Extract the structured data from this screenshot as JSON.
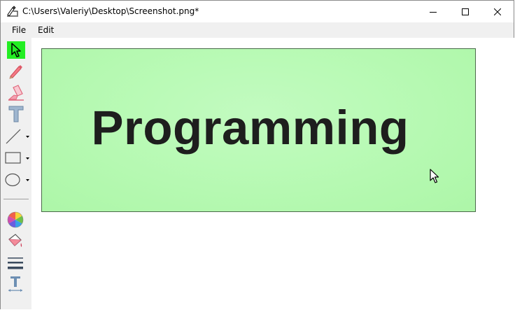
{
  "window": {
    "title": "C:\\Users\\Valeriy\\Desktop\\Screenshot.png*"
  },
  "menu": {
    "items": [
      "File",
      "Edit"
    ]
  },
  "toolbar": {
    "tools": [
      {
        "name": "select-tool",
        "icon": "arrow-cursor-icon",
        "active": true
      },
      {
        "name": "pencil-tool",
        "icon": "pencil-icon"
      },
      {
        "name": "highlighter-tool",
        "icon": "highlighter-icon"
      },
      {
        "name": "text-tool",
        "icon": "text-t-icon"
      },
      {
        "name": "line-tool",
        "icon": "line-icon",
        "dropdown": true
      },
      {
        "name": "rectangle-tool",
        "icon": "rectangle-icon",
        "dropdown": true
      },
      {
        "name": "ellipse-tool",
        "icon": "ellipse-icon",
        "dropdown": true
      },
      {
        "name": "color-picker",
        "icon": "color-wheel-icon"
      },
      {
        "name": "fill-tool",
        "icon": "paint-bucket-icon"
      },
      {
        "name": "line-width-tool",
        "icon": "line-width-icon"
      },
      {
        "name": "font-size-tool",
        "icon": "text-size-icon"
      }
    ],
    "accent": "#23ee23"
  },
  "canvas": {
    "image_text": "Programming",
    "image_background": "#b5f9b1",
    "text_color": "#1e1e1e"
  }
}
